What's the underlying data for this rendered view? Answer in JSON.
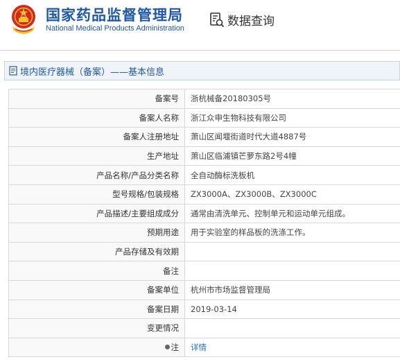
{
  "header": {
    "brand_cn": "国家药品监督管理局",
    "brand_en": "National Medical Products Administration",
    "query_label": "数据查询",
    "emblem_icon": "national-emblem",
    "query_icon": "document-search-icon",
    "brand_color": "#1f58a8"
  },
  "section": {
    "title": "境内医疗器械（备案）——基本信息",
    "icon": "document-icon"
  },
  "rows": [
    {
      "label": "备案号",
      "value": "浙杭械备20180305号"
    },
    {
      "label": "备案人名称",
      "value": "浙江众申生物科技有限公司"
    },
    {
      "label": "备案人注册地址",
      "value": "萧山区闻堰街道时代大道4887号"
    },
    {
      "label": "生产地址",
      "value": "萧山区临浦镇芒萝东路2号4幢"
    },
    {
      "label": "产品名称/产品分类名称",
      "value": "全自动酶标洗板机"
    },
    {
      "label": "型号规格/包装规格",
      "value": "ZX3000A、ZX3000B、ZX3000C"
    },
    {
      "label": "产品描述/主要组成成分",
      "value": "通常由清洗单元、控制单元和运动单元组成。"
    },
    {
      "label": "预期用途",
      "value": "用于实验室的样品板的洗涤工作。"
    },
    {
      "label": "产品存储及有效期",
      "value": ""
    },
    {
      "label": "备注",
      "value": ""
    },
    {
      "label": "备案单位",
      "value": "杭州市市场监督管理局"
    },
    {
      "label": "备案日期",
      "value": "2019-03-14"
    },
    {
      "label": "变更情况",
      "value": ""
    },
    {
      "label": "注",
      "value": "详情",
      "icon": "pin-icon",
      "link_color": "#1f6ccf"
    }
  ]
}
